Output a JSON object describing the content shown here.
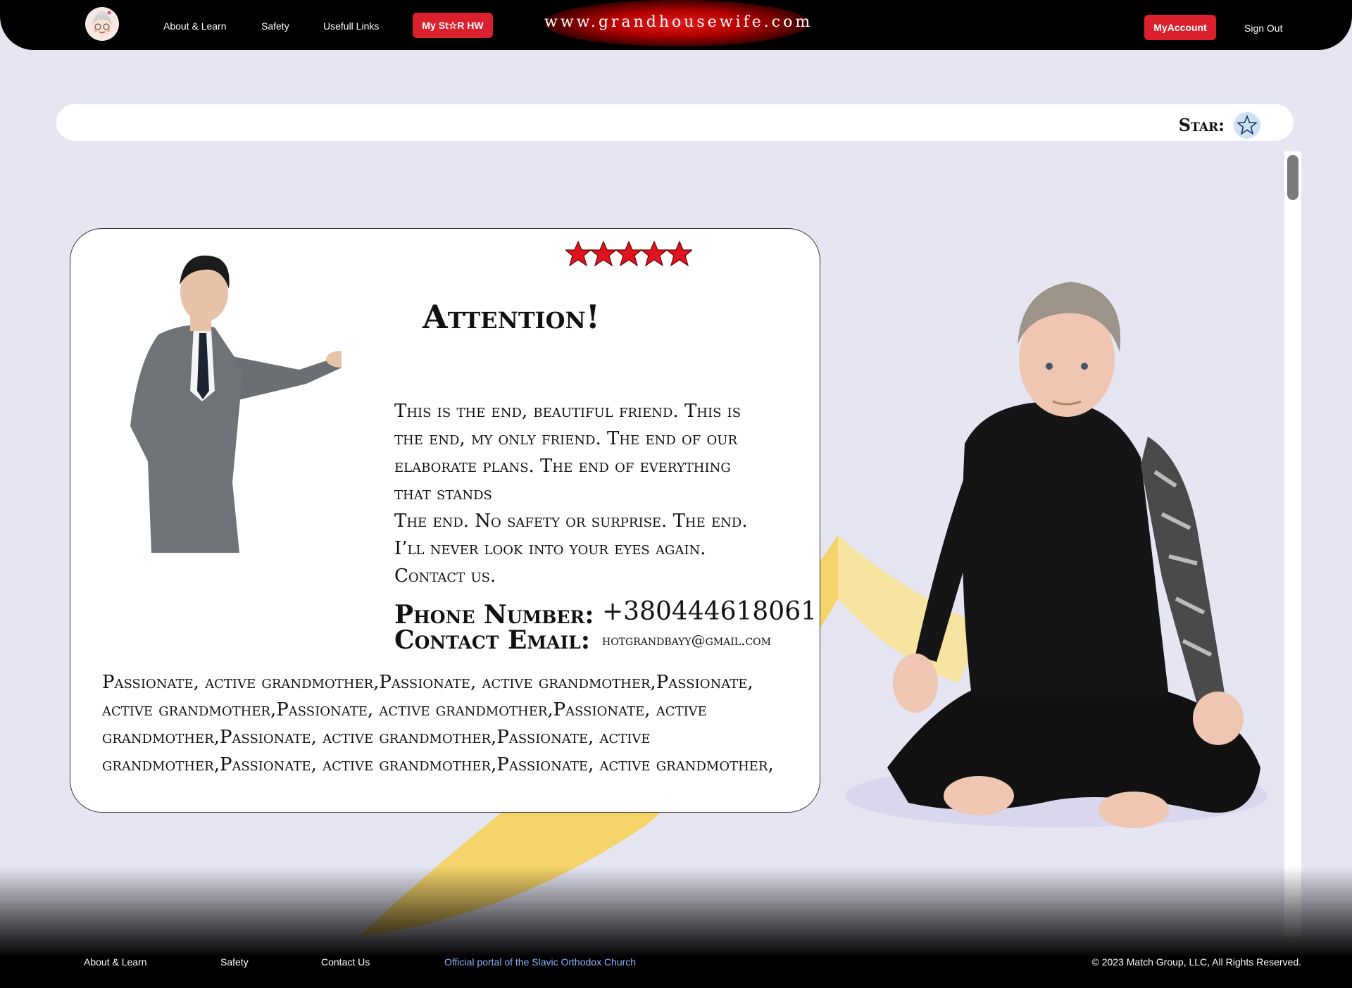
{
  "nav": {
    "links": [
      {
        "label": "About & Learn"
      },
      {
        "label": "Safety"
      },
      {
        "label": "Usefull Links"
      }
    ],
    "my_star_button": "My St☆R HW",
    "site_title": "www.grandhousewife.com",
    "my_account_button": "MyAccount",
    "sign_out": "Sign Out"
  },
  "star_bar": {
    "label": "Star:",
    "icon": "star-outline-icon"
  },
  "card": {
    "rating_stars": 5,
    "title": "Attention!",
    "body_paragraphs": [
      "This is the end, beautiful friend. This is the end, my only friend. The end of our elaborate plans. The end of everything that stands",
      "The end. No safety or surprise. The end. I’ll never look into your eyes again. Contact us."
    ],
    "phone_label": "Phone Number:",
    "phone_value": "+380444618061",
    "email_label": "Contact Email:",
    "email_value": "hotgrandbayy@gmail.com",
    "description": "Passionate, active grandmother,Passionate, active grandmother,Passionate, active grandmother,Passionate, active grandmother,Passionate, active grandmother,Passionate, active grandmother,Passionate, active grandmother,Passionate, active grandmother,Passionate, active grandmother,"
  },
  "footer": {
    "links": [
      {
        "label": "About & Learn"
      },
      {
        "label": "Safety"
      },
      {
        "label": "Contact Us"
      }
    ],
    "portal_link": "Official portal of the Slavic Orthodox Church",
    "copyright": "© 2023 Match Group, LLC, All Rights Reserved."
  },
  "colors": {
    "accent_red": "#d9202c",
    "page_bg": "#e6e6f3",
    "portal_link": "#8ab4ff"
  }
}
